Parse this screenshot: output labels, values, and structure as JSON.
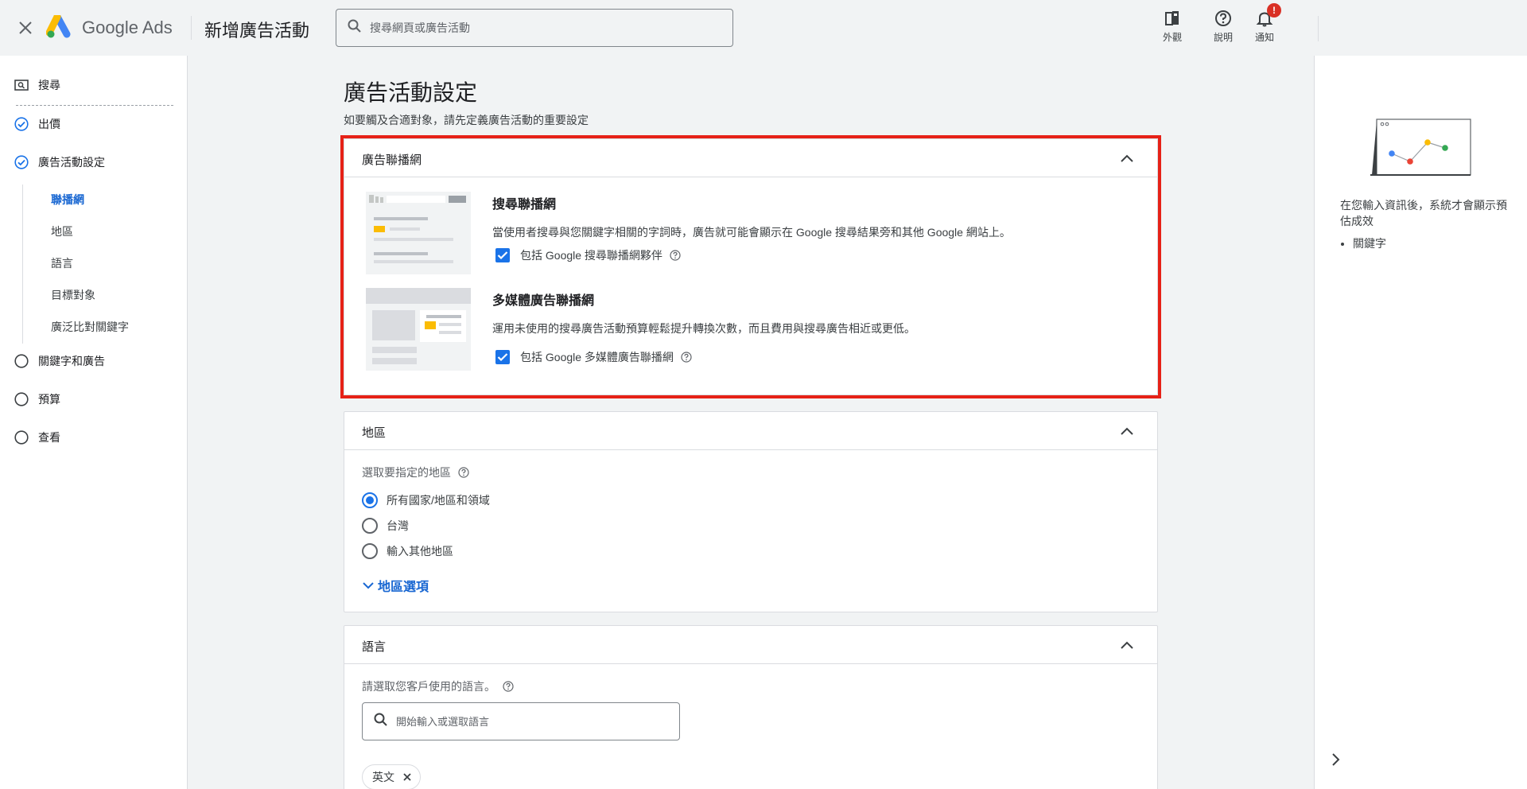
{
  "header": {
    "brand_name": "Google",
    "brand_product": "Ads",
    "page_title": "新增廣告活動",
    "search_placeholder": "搜尋網頁或廣告活動",
    "actions": [
      {
        "label": "外觀",
        "icon": "appearance-icon"
      },
      {
        "label": "說明",
        "icon": "help-icon"
      },
      {
        "label": "通知",
        "icon": "bell-icon",
        "badge": "!"
      }
    ]
  },
  "nav": {
    "items": [
      {
        "label": "搜尋",
        "state": "search"
      },
      {
        "label": "出價",
        "state": "done"
      },
      {
        "label": "廣告活動設定",
        "state": "done"
      },
      {
        "label": "關鍵字和廣告",
        "state": "todo"
      },
      {
        "label": "預算",
        "state": "todo"
      },
      {
        "label": "查看",
        "state": "todo"
      }
    ],
    "sub_items": [
      "聯播網",
      "地區",
      "語言",
      "目標對象",
      "廣泛比對關鍵字"
    ],
    "active_sub": "聯播網"
  },
  "main": {
    "title": "廣告活動設定",
    "subtitle": "如要觸及合適對象，請先定義廣告活動的重要設定"
  },
  "networks_card": {
    "title": "廣告聯播網",
    "search": {
      "title": "搜尋聯播網",
      "desc": "當使用者搜尋與您關鍵字相關的字詞時，廣告就可能會顯示在 Google 搜尋結果旁和其他 Google 網站上。",
      "checkbox_label": "包括 Google 搜尋聯播網夥伴",
      "checked": true
    },
    "display": {
      "title": "多媒體廣告聯播網",
      "desc": "運用未使用的搜尋廣告活動預算輕鬆提升轉換次數，而且費用與搜尋廣告相近或更低。",
      "checkbox_label": "包括 Google 多媒體廣告聯播網",
      "checked": true
    }
  },
  "locations_card": {
    "title": "地區",
    "field_label": "選取要指定的地區",
    "options": [
      "所有國家/地區和領域",
      "台灣",
      "輸入其他地區"
    ],
    "selected": "所有國家/地區和領域",
    "more_link": "地區選項"
  },
  "languages_card": {
    "title": "語言",
    "field_label": "請選取您客戶使用的語言。",
    "input_placeholder": "開始輸入或選取語言",
    "chips": [
      "英文"
    ]
  },
  "right_panel": {
    "text": "在您輸入資訊後，系統才會顯示預估成效",
    "list": [
      "關鍵字"
    ]
  },
  "colors": {
    "accent": "#1a73e8",
    "link": "#1967d2",
    "highlight": "#e62117",
    "badge": "#d93025"
  }
}
